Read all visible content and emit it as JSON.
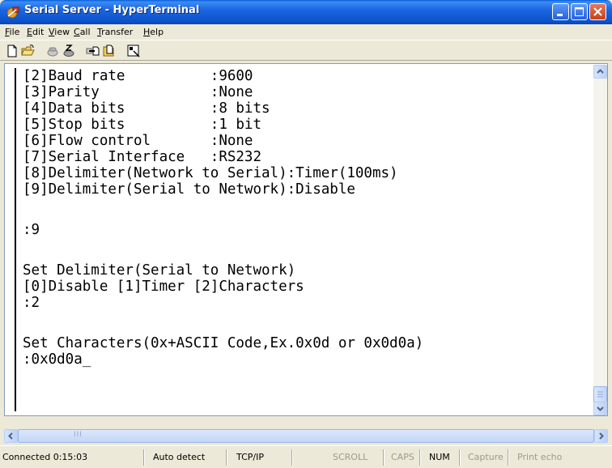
{
  "window": {
    "title": "Serial Server - HyperTerminal"
  },
  "menu": {
    "items": [
      {
        "label": "File",
        "accel": "F",
        "rest": "ile"
      },
      {
        "label": "Edit",
        "accel": "E",
        "rest": "dit"
      },
      {
        "label": "View",
        "accel": "V",
        "rest": "iew"
      },
      {
        "label": "Call",
        "accel": "C",
        "rest": "all"
      },
      {
        "label": "Transfer",
        "accel": "T",
        "rest": "ransfer"
      },
      {
        "label": "Help",
        "accel": "H",
        "rest": "elp"
      }
    ]
  },
  "toolbar": {
    "icons": [
      "new-icon",
      "open-icon",
      "call-icon",
      "disconnect-icon",
      "send-icon",
      "receive-icon",
      "properties-icon"
    ]
  },
  "terminal": {
    "lines": [
      "[2]Baud rate          :9600",
      "[3]Parity             :None",
      "[4]Data bits          :8 bits",
      "[5]Stop bits          :1 bit",
      "[6]Flow control       :None",
      "[7]Serial Interface   :RS232",
      "[8]Delimiter(Network to Serial):Timer(100ms)",
      "[9]Delimiter(Serial to Network):Disable",
      "",
      ":9",
      "",
      "Set Delimiter(Serial to Network)",
      "[0]Disable [1]Timer [2]Characters",
      ":2",
      "",
      "Set Characters(0x+ASCII Code,Ex.0x0d or 0x0d0a)",
      ":0x0d0a_"
    ]
  },
  "statusbar": {
    "connected": "Connected 0:15:03",
    "detect": "Auto detect",
    "protocol": "TCP/IP",
    "scroll": "SCROLL",
    "caps": "CAPS",
    "num": "NUM",
    "capture": "Capture",
    "print_echo": "Print echo"
  },
  "scrollbar": {
    "horizontal_grip": "III"
  },
  "colors": {
    "titlebar": "#0a53cc",
    "terminal_bg": "#ffffff",
    "terminal_text": "#000000"
  }
}
